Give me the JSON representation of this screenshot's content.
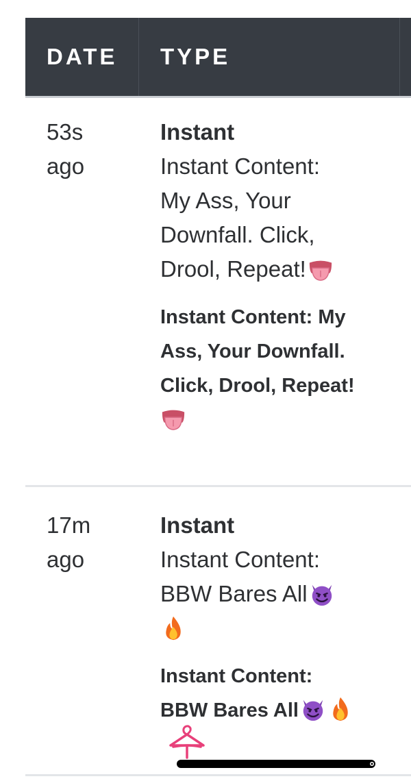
{
  "table": {
    "headers": {
      "date": "DATE",
      "type": "TYPE"
    },
    "rows": [
      {
        "date_line1": "53s",
        "date_line2": "ago",
        "type_title": "Instant",
        "description_lines": [
          "Instant Content:",
          "My Ass, Your",
          "Downfall. Click,",
          "Drool, Repeat!"
        ],
        "bold_lines": [
          "Instant Content: My",
          "Ass, Your Downfall.",
          "Click, Drool, Repeat!"
        ],
        "emoji": "tongue-emoji"
      },
      {
        "date_line1": "17m",
        "date_line2": "ago",
        "type_title": "Instant",
        "description_lines": [
          "Instant Content:",
          "BBW Bares All"
        ],
        "bold_lines": [
          "Instant Content:",
          "BBW Bares All"
        ],
        "emoji_desc": [
          "smiling-devil-emoji",
          "fire-emoji"
        ],
        "emoji_bold": [
          "smiling-devil-emoji",
          "fire-emoji"
        ]
      }
    ]
  },
  "overlays": {
    "hanger_icon": "pink-clothes-hanger-icon"
  },
  "colors": {
    "header_bg": "#373c43",
    "header_text": "#ffffff",
    "body_text": "#2e3033",
    "divider": "#e3e5e8",
    "hanger_pink": "#e8407a"
  }
}
